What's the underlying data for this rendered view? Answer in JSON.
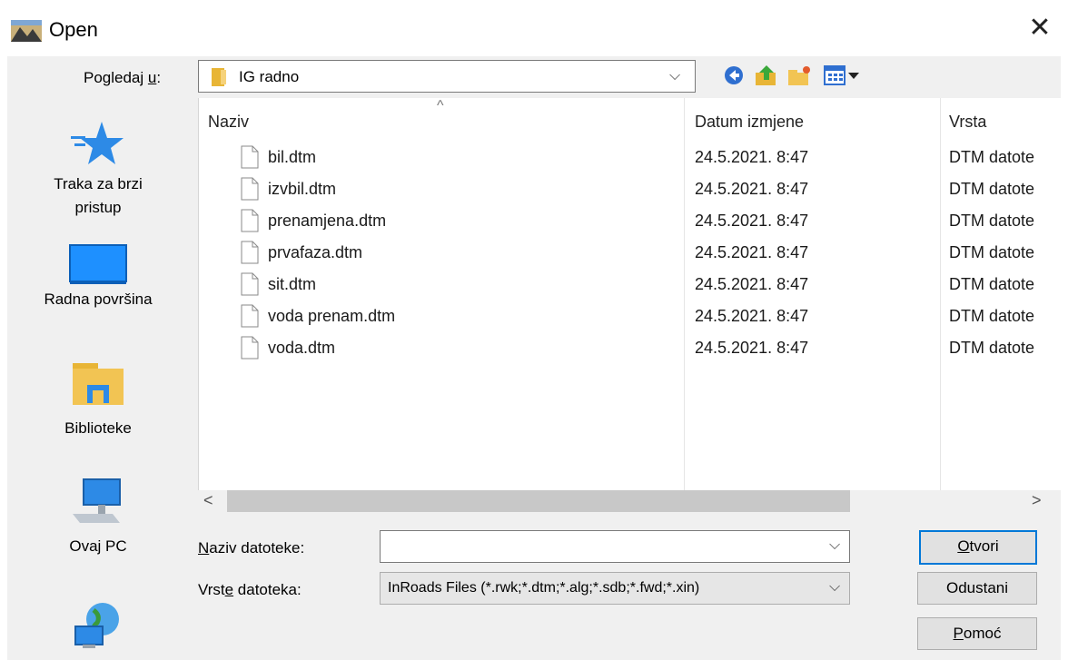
{
  "window": {
    "title": "Open",
    "close_glyph": "✕"
  },
  "look_in": {
    "label_pre": "Pogledaj ",
    "label_key": "u",
    "label_post": ":",
    "value": "IG radno",
    "chevron": "⌵"
  },
  "toolbar": {
    "icons": [
      "back-icon",
      "up-folder-icon",
      "new-folder-icon",
      "view-menu-icon"
    ]
  },
  "places": [
    {
      "label": "Traka za brzi pristup",
      "icon": "quick-access-star-icon"
    },
    {
      "label": "Radna površina",
      "icon": "desktop-icon"
    },
    {
      "label": "Biblioteke",
      "icon": "libraries-icon"
    },
    {
      "label": "Ovaj PC",
      "icon": "this-pc-icon"
    },
    {
      "label": "",
      "icon": "network-icon"
    }
  ],
  "columns": {
    "name": "Naziv",
    "date": "Datum izmjene",
    "type": "Vrsta",
    "sort_glyph": "^"
  },
  "files": [
    {
      "name": "bil.dtm",
      "date": "24.5.2021. 8:47",
      "type": "DTM datote"
    },
    {
      "name": "izvbil.dtm",
      "date": "24.5.2021. 8:47",
      "type": "DTM datote"
    },
    {
      "name": "prenamjena.dtm",
      "date": "24.5.2021. 8:47",
      "type": "DTM datote"
    },
    {
      "name": "prvafaza.dtm",
      "date": "24.5.2021. 8:47",
      "type": "DTM datote"
    },
    {
      "name": "sit.dtm",
      "date": "24.5.2021. 8:47",
      "type": "DTM datote"
    },
    {
      "name": "voda prenam.dtm",
      "date": "24.5.2021. 8:47",
      "type": "DTM datote"
    },
    {
      "name": "voda.dtm",
      "date": "24.5.2021. 8:47",
      "type": "DTM datote"
    }
  ],
  "scroll": {
    "left_glyph": "<",
    "right_glyph": ">"
  },
  "filename": {
    "label_key": "N",
    "label_rest": "aziv datoteke:",
    "value": "",
    "chevron": "⌵"
  },
  "filetype": {
    "label_pre": "Vrst",
    "label_key": "e",
    "label_post": " datoteka:",
    "value": "InRoads Files (*.rwk;*.dtm;*.alg;*.sdb;*.fwd;*.xin)",
    "chevron": "⌵"
  },
  "buttons": {
    "open_key": "O",
    "open_rest": "tvori",
    "cancel": "Odustani",
    "help_key": "P",
    "help_rest": "omoć"
  },
  "colors": {
    "accent": "#0078d7",
    "folder": "#e8b536",
    "desktop": "#1e90ff"
  }
}
